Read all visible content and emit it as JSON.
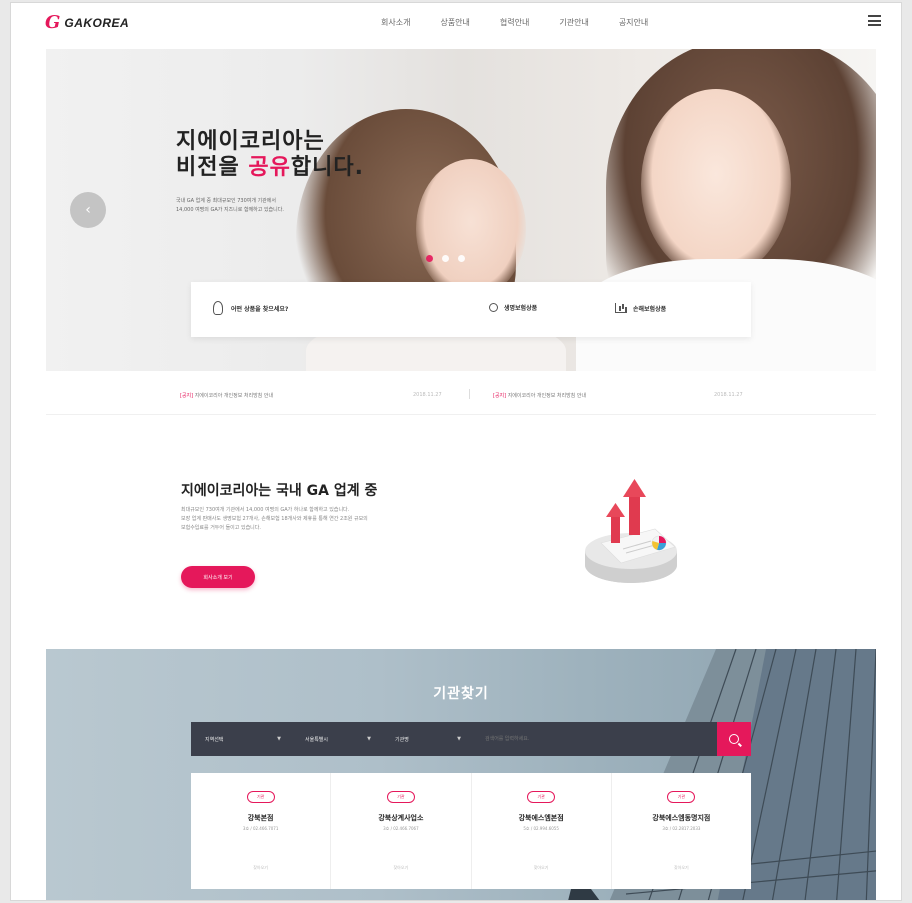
{
  "header": {
    "logo_mark": "G",
    "logo_text": "GAKOREA",
    "nav": [
      "회사소개",
      "상품안내",
      "협력안내",
      "기관안내",
      "공지안내"
    ]
  },
  "hero": {
    "title_line1": "지에이코리아는",
    "title_line2_pre": "비전을 ",
    "title_line2_accent": "공유",
    "title_line2_post": "합니다.",
    "desc_line1": "국내 GA 업계 중 최대규모인 730여개 기관에서",
    "desc_line2": "14,000 여명의 GA가 지즈니로 함께하고 있습니다.",
    "prev_glyph": "‹",
    "dots": 3,
    "quick": {
      "q1_label": "어떤 상품을 찾으세요?",
      "q2_label": "생명보험상품",
      "q3_label": "손해보험상품"
    }
  },
  "notice": {
    "items": [
      {
        "tag": "[공지]",
        "text": " 지에이코리아 개인정보 처리방침 안내",
        "date": "2018.11.27"
      },
      {
        "tag": "[공지]",
        "text": " 지에이코리아 개인정보 처리방침 안내",
        "date": "2018.11.27"
      }
    ]
  },
  "about": {
    "title": "지에이코리아는 국내 GA 업계 중",
    "desc_line1": "최대규모인 730여개 기관에서 14,000 여명의 GA가 하나로 함께하고 있습니다.",
    "desc_line2": "보장 업계 판매사도 생명보험 27개사, 손해보험 18개사와 제휴를 통해 연간 2조원 규모의",
    "desc_line3": "보험수입료를 거두어 들이고 있습니다.",
    "button": "회사소개 보기"
  },
  "agency": {
    "title": "기관찾기",
    "selects": [
      "지역선택",
      "서울특별시",
      "기관명"
    ],
    "keyword_placeholder": "검색어를 입력하세요.",
    "cards": [
      {
        "badge": "기관",
        "name": "강북본점",
        "addr": "3호 / 02.466.7071",
        "more": "찾아오기"
      },
      {
        "badge": "기관",
        "name": "강북상계사업소",
        "addr": "3호 / 02.466.7067",
        "more": "찾아오기"
      },
      {
        "badge": "기관",
        "name": "강북에스엠본점",
        "addr": "5호 / 02.994.6055",
        "more": "찾아오기"
      },
      {
        "badge": "기관",
        "name": "강북에스엠동명지점",
        "addr": "3호 / 02.2817.2033",
        "more": "찾아오기"
      }
    ]
  },
  "colors": {
    "accent": "#e5185b",
    "search_bar": "#3b3f4b"
  }
}
